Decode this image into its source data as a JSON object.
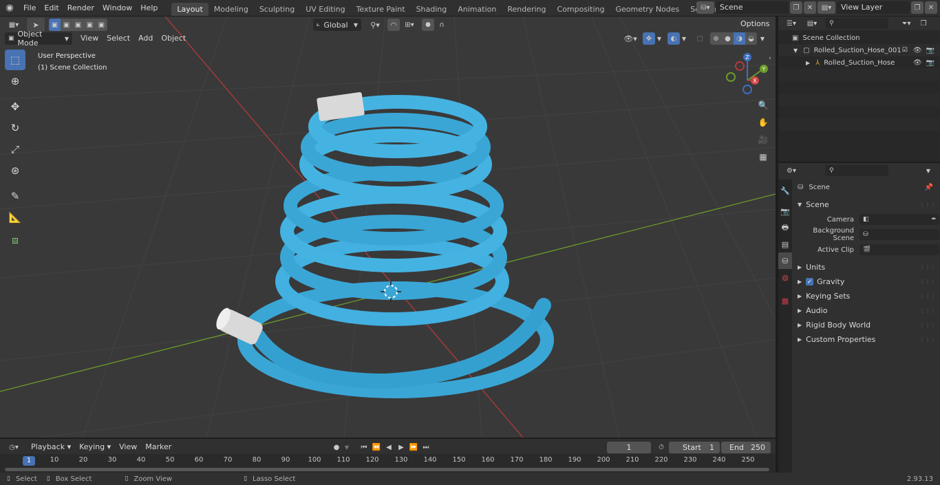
{
  "topbar": {
    "menus": [
      "File",
      "Edit",
      "Render",
      "Window",
      "Help"
    ],
    "workspaces": [
      "Layout",
      "Modeling",
      "Sculpting",
      "UV Editing",
      "Texture Paint",
      "Shading",
      "Animation",
      "Rendering",
      "Compositing",
      "Geometry Nodes",
      "Scripting"
    ],
    "active_workspace": "Layout",
    "add_tab": "+",
    "scene_name": "Scene",
    "view_layer": "View Layer"
  },
  "viewport": {
    "mode": "Object Mode",
    "menus": [
      "View",
      "Select",
      "Add",
      "Object"
    ],
    "transform_orientation": "Global",
    "options_label": "Options",
    "overlay_title": "User Perspective",
    "overlay_subtitle": "(1) Scene Collection",
    "gizmo_axes": [
      "Z",
      "Y",
      "X"
    ]
  },
  "outliner": {
    "collection": "Scene Collection",
    "items": [
      {
        "label": "Rolled_Suction_Hose_001"
      },
      {
        "label": "Rolled_Suction_Hose"
      }
    ]
  },
  "properties": {
    "context_label": "Scene",
    "panel_title": "Scene",
    "fields": [
      {
        "label": "Camera",
        "value": ""
      },
      {
        "label": "Background Scene",
        "value": ""
      },
      {
        "label": "Active Clip",
        "value": ""
      }
    ],
    "subpanels": [
      "Units",
      "Gravity",
      "Keying Sets",
      "Audio",
      "Rigid Body World",
      "Custom Properties"
    ]
  },
  "timeline": {
    "menus": [
      "Playback",
      "Keying",
      "View",
      "Marker"
    ],
    "current_frame": "1",
    "start_label": "Start",
    "start_value": "1",
    "end_label": "End",
    "end_value": "250",
    "ticks": [
      "10",
      "20",
      "30",
      "40",
      "50",
      "60",
      "70",
      "80",
      "90",
      "100",
      "110",
      "120",
      "130",
      "140",
      "150",
      "160",
      "170",
      "180",
      "190",
      "200",
      "210",
      "220",
      "230",
      "240",
      "250"
    ],
    "playhead_label": "1"
  },
  "statusbar": {
    "select": "Select",
    "box_select": "Box Select",
    "zoom_view": "Zoom View",
    "lasso_select": "Lasso Select",
    "version": "2.93.13"
  },
  "colors": {
    "accent": "#4772b3",
    "hose": "#3aa6d6",
    "fitting": "#d9d9d9",
    "x_axis": "#b33a3a",
    "y_axis": "#6c9b2a"
  }
}
